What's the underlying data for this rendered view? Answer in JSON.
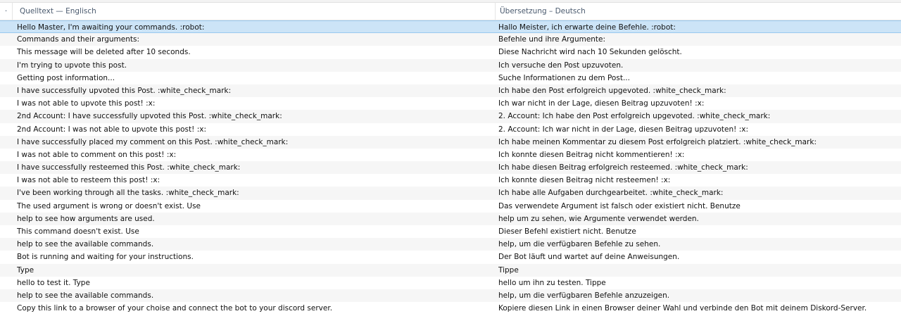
{
  "header": {
    "marker": "·",
    "source_col": "Quelltext — Englisch",
    "target_col": "Übersetzung – Deutsch"
  },
  "rows": [
    {
      "source": "Hello Master, I'm awaiting your commands. :robot:",
      "target": "Hallo Meister, ich erwarte deine Befehle. :robot:",
      "selected": true
    },
    {
      "source": "Commands and their arguments:",
      "target": "Befehle und ihre Argumente:"
    },
    {
      "source": "This message will be deleted after 10 seconds.",
      "target": "Diese Nachricht wird nach 10 Sekunden gelöscht."
    },
    {
      "source": "I'm trying to upvote this post.",
      "target": "Ich versuche den Post upzuvoten."
    },
    {
      "source": "Getting post information...",
      "target": "Suche Informationen zu dem Post..."
    },
    {
      "source": "I have successfully upvoted this Post. :white_check_mark:",
      "target": "Ich habe den Post erfolgreich upgevoted. :white_check_mark:"
    },
    {
      "source": "I was not able to upvote this post! :x:",
      "target": "Ich war nicht in der Lage, diesen Beitrag upzuvoten! :x:"
    },
    {
      "source": "2nd Account: I have successfully upvoted this Post. :white_check_mark:",
      "target": "2. Account: Ich habe den Post erfolgreich upgevoted. :white_check_mark:"
    },
    {
      "source": "2nd Account: I was not able to upvote this post! :x:",
      "target": "2. Account: Ich war nicht in der Lage, diesen Beitrag upzuvoten! :x:"
    },
    {
      "source": "I have successfully placed my comment on this Post. :white_check_mark:",
      "target": "Ich habe meinen Kommentar zu diesem Post erfolgreich platziert. :white_check_mark:"
    },
    {
      "source": "I was not able to comment on this post! :x:",
      "target": "Ich konnte diesen Beitrag nicht kommentieren! :x:"
    },
    {
      "source": "I have successfully resteemed this Post. :white_check_mark:",
      "target": "Ich habe diesen Beitrag erfolgreich resteemed. :white_check_mark:"
    },
    {
      "source": "I was not able to resteem this post! :x:",
      "target": "Ich konnte diesen Beitrag nicht resteemen! :x:"
    },
    {
      "source": "I've been working through all the tasks. :white_check_mark:",
      "target": "Ich habe alle Aufgaben durchgearbeitet. :white_check_mark:"
    },
    {
      "source": "The used argument is wrong or doesn't exist. Use",
      "target": "Das verwendete Argument ist falsch oder existiert nicht. Benutze"
    },
    {
      "source": "help to see how arguments are used.",
      "target": "help um zu sehen, wie Argumente verwendet werden."
    },
    {
      "source": "This command doesn't exist. Use",
      "target": "Dieser Befehl existiert nicht. Benutze"
    },
    {
      "source": "help to see the available commands.",
      "target": "help, um die verfügbaren Befehle zu sehen."
    },
    {
      "source": "Bot is running and waiting for your instructions.",
      "target": "Der Bot läuft und wartet auf deine Anweisungen."
    },
    {
      "source": "Type",
      "target": "Tippe"
    },
    {
      "source": "hello to test it. Type",
      "target": "hello um ihn zu testen. Tippe"
    },
    {
      "source": "help to see the available commands.",
      "target": "help, um die verfügbaren Befehle anzuzeigen."
    },
    {
      "source": "Copy this link to a browser of your choise and connect the bot to your discord server.",
      "target": "Kopiere diesen Link in einen Browser deiner Wahl und verbinde den Bot mit deinem Diskord-Server."
    }
  ]
}
